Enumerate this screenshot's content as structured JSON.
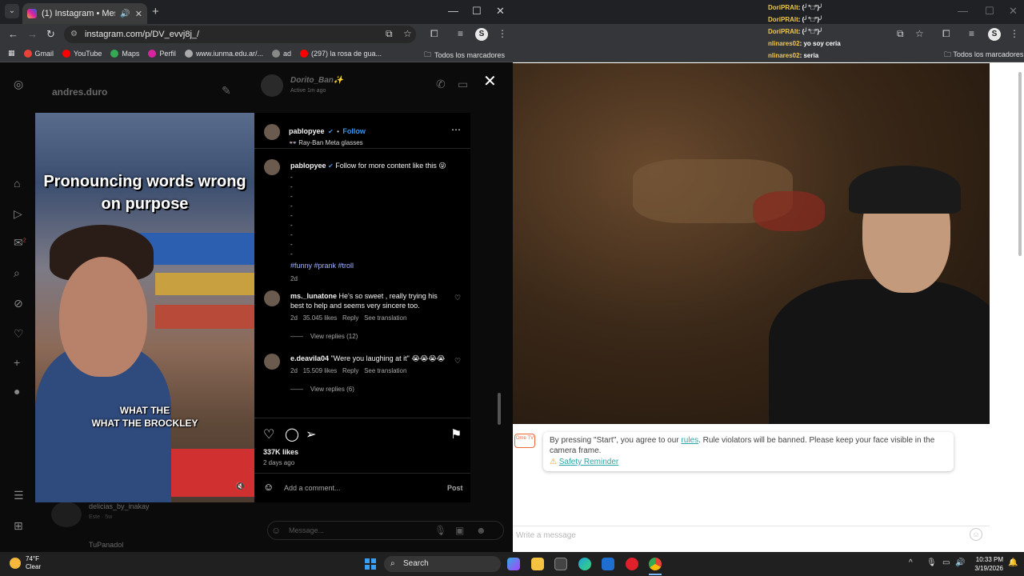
{
  "left_browser": {
    "tab_title": "(1) Instagram • Messages",
    "url": "instagram.com/p/DV_evvj8j_/",
    "profile_letter": "S",
    "bookmarks": [
      "Gmail",
      "YouTube",
      "Maps",
      "Perfil",
      "www.iunma.edu.ar/...",
      "ad",
      "(297) la rosa de gua..."
    ],
    "all_bookmarks": "Todos los marcadores"
  },
  "ig_background": {
    "username": "andres.duro",
    "chat_name": "Dorito_Ban✨",
    "chat_status": "Active 1m ago",
    "list_item_1": "delicias_by_inakay",
    "list_item_1_sub": "Este · 5w",
    "list_item_2": "TuPanadol",
    "message_placeholder": "Message...",
    "notification_count": "2"
  },
  "post": {
    "video_title": "Pronouncing words wrong on purpose",
    "video_caption_line1": "WHAT THE",
    "video_caption_line2": "WHAT THE BROCKLEY",
    "author": "pablopyee",
    "follow": "Follow",
    "glasses": "Ray-Ban Meta glasses",
    "caption": "Follow for more content like this 😜",
    "hashtags": "#funny #prank #troll",
    "post_age": "2d",
    "comments": [
      {
        "user": "ms._lunatone",
        "text": "He's so sweet , really trying his best to help and seems very sincere too.",
        "age": "2d",
        "likes": "35.045 likes",
        "reply": "Reply",
        "translate": "See translation",
        "view_replies": "View replies (12)"
      },
      {
        "user": "e.deavila04",
        "text": "\"Were you laughing at it\" 😭😭😭😭",
        "age": "2d",
        "likes": "15.509 likes",
        "reply": "Reply",
        "translate": "See translation",
        "view_replies": "View replies (6)"
      }
    ],
    "likes_total": "337K likes",
    "posted_ago": "2 days ago",
    "add_comment_placeholder": "Add a comment...",
    "post_button": "Post"
  },
  "right_page": {
    "chat_log": [
      {
        "name": "DoriPRAlt",
        "text": ": (╯°□°)╯"
      },
      {
        "name": "DoriPRAlt",
        "text": ": (╯°□°)╯"
      },
      {
        "name": "DoriPRAlt",
        "text": ": (╯°□°)╯"
      },
      {
        "name": "nlinares02",
        "text": ": yo soy ceria"
      },
      {
        "name": "nlinares02",
        "text": ": seria"
      }
    ],
    "profile_letter": "S",
    "all_bookmarks": "Todos los marcadores",
    "logo_text": "Ome TV",
    "notice_pre": "By pressing \"Start\", you agree to our ",
    "notice_link": "rules",
    "notice_post": ". Rule violators will be banned. Please keep your face visible in the camera frame.",
    "safety_reminder": "Safety Reminder",
    "message_placeholder": "Write a message"
  },
  "taskbar": {
    "temperature": "74°F",
    "condition": "Clear",
    "search": "Search",
    "time": "10:33 PM",
    "date": "3/19/2026"
  }
}
